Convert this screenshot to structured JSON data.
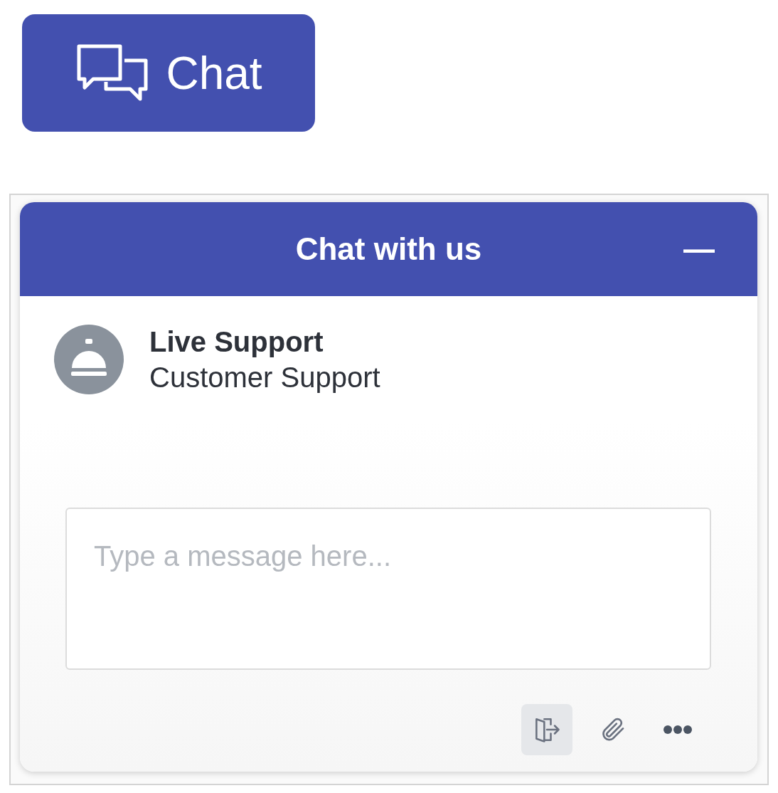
{
  "launcher": {
    "label": "Chat"
  },
  "widget": {
    "title": "Chat with us",
    "minimize": "—"
  },
  "agent": {
    "name": "Live Support",
    "department": "Customer Support"
  },
  "composer": {
    "placeholder": "Type a message here..."
  },
  "toolbar": [
    {
      "kind": "exit",
      "highlighted": true
    },
    {
      "kind": "attach",
      "highlighted": false
    },
    {
      "kind": "more",
      "highlighted": false
    }
  ]
}
